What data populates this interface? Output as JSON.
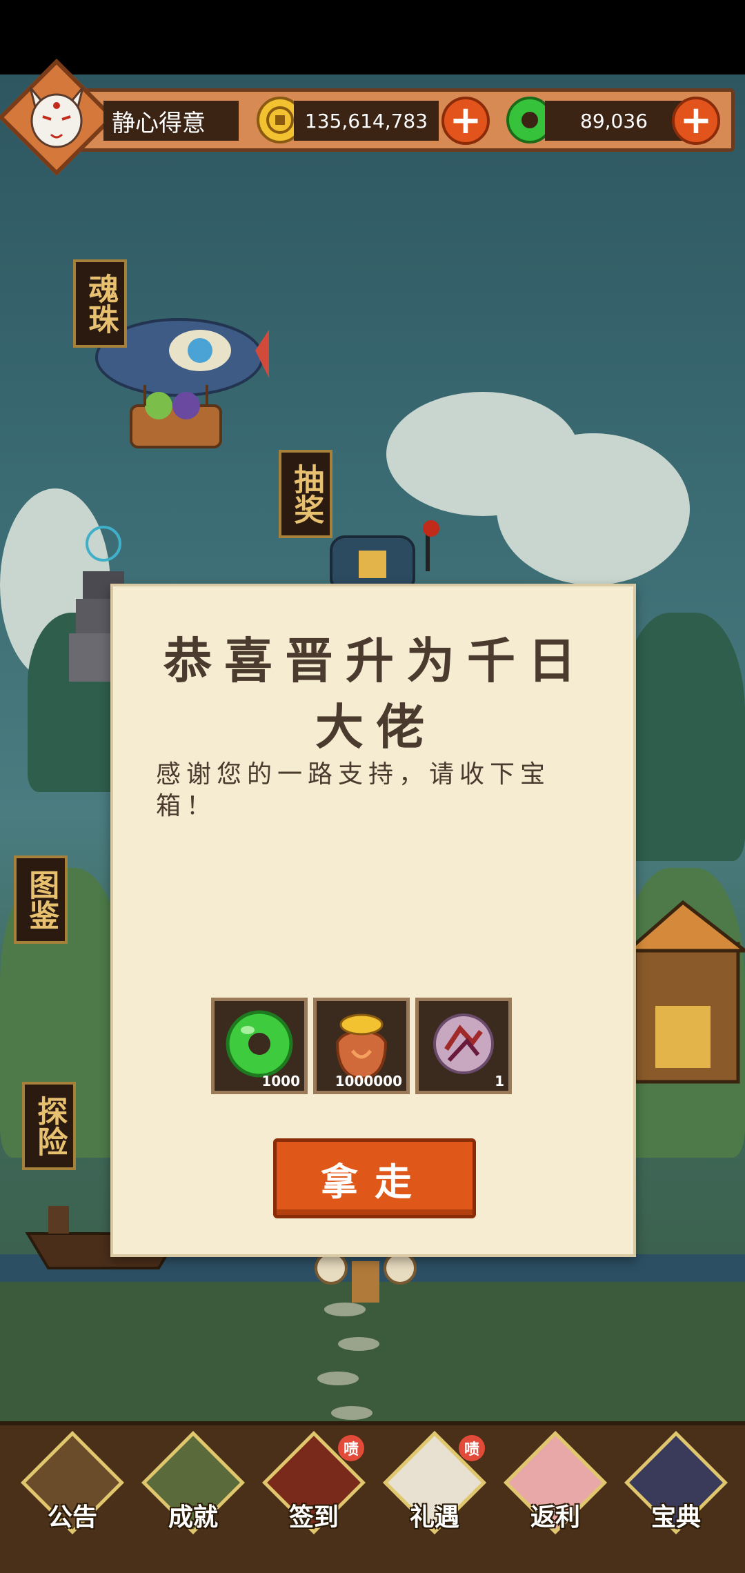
{
  "player": {
    "name": "静心得意"
  },
  "currency": {
    "gold": "135,614,783",
    "jade": "89,036"
  },
  "side_signs": {
    "soul_orb": "魂珠",
    "lottery": "抽奖",
    "atlas": "图鉴",
    "explore": "探险"
  },
  "dialog": {
    "title": "恭喜晋升为千日大佬",
    "message": "感谢您的一路支持，请收下宝箱！",
    "rewards": [
      {
        "icon": "jade-ring-icon",
        "count": "1000"
      },
      {
        "icon": "gold-bag-icon",
        "count": "1000000"
      },
      {
        "icon": "soul-orb-icon",
        "count": "1"
      }
    ],
    "button": "拿走"
  },
  "bottom_nav": [
    {
      "label": "公告",
      "badge": ""
    },
    {
      "label": "成就",
      "badge": ""
    },
    {
      "label": "签到",
      "badge": "啧"
    },
    {
      "label": "礼遇",
      "badge": "啧"
    },
    {
      "label": "返利",
      "badge": ""
    },
    {
      "label": "宝典",
      "badge": ""
    }
  ],
  "colors": {
    "accent_orange": "#e0571a",
    "parchment": "#f6ecd2",
    "wood_dark": "#3b2414"
  }
}
